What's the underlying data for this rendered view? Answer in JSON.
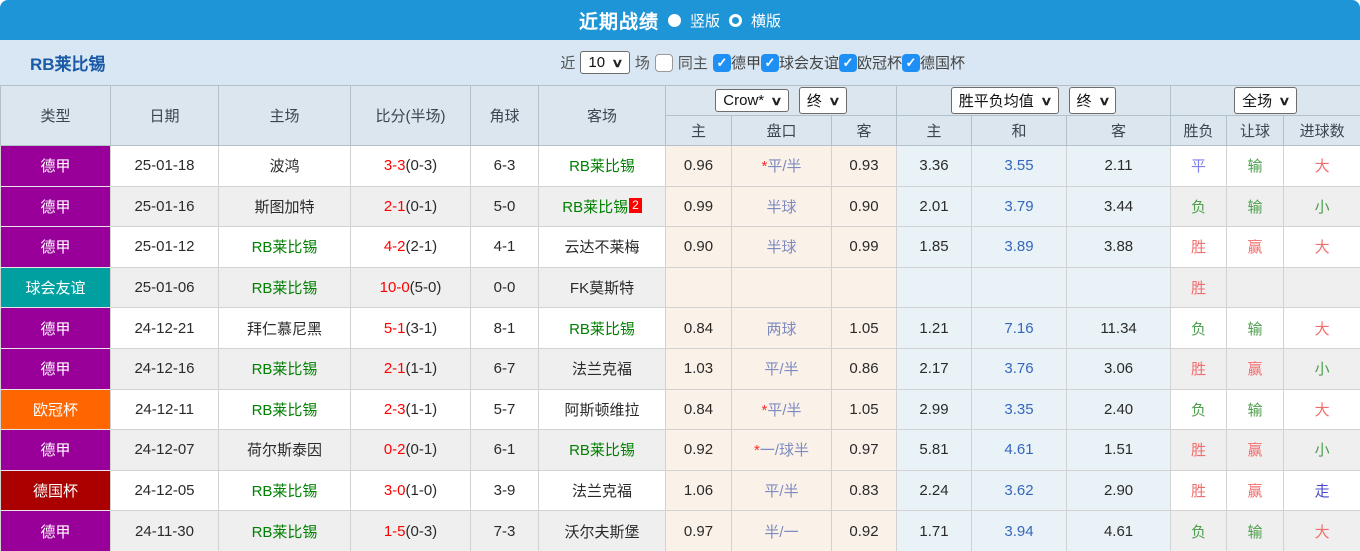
{
  "icons": {
    "chevron_down": "∨",
    "check": "✓"
  },
  "colors": {
    "topbar_blue": "#1e95d7",
    "filterbar_blue": "#d8e7f3",
    "header_gray": "#dce6ee",
    "league_dejia": "#990099",
    "league_friendly": "#00a0a0",
    "league_ucl": "#ff6600",
    "league_dfb": "#aa0000",
    "team_highlight_green": "#008000",
    "score_red": "#fe0000",
    "handicap_slate": "#7e8bc0",
    "avg_draw_blue": "#3666bb"
  },
  "topbar": {
    "title": "近期战绩",
    "vertical_label": "竖版",
    "horizontal_label": "横版"
  },
  "filterbar": {
    "team": "RB莱比锡",
    "recent_label": "近",
    "recent_count": "10",
    "matches_label": "场",
    "same_home_label": "同主",
    "leagues": [
      {
        "label": "德甲",
        "checked": true
      },
      {
        "label": "球会友谊",
        "checked": true
      },
      {
        "label": "欧冠杯",
        "checked": true
      },
      {
        "label": "德国杯",
        "checked": true
      }
    ]
  },
  "table": {
    "left_cols": [
      "类型",
      "日期",
      "主场",
      "比分(半场)",
      "角球",
      "客场"
    ],
    "group1": {
      "select_market": "Crow*",
      "select_time": "终",
      "cols": [
        "主",
        "盘口",
        "客"
      ]
    },
    "group2": {
      "select_market": "胜平负均值",
      "select_time": "终",
      "cols": [
        "主",
        "和",
        "客"
      ]
    },
    "group3": {
      "select_scope": "全场",
      "cols": [
        "胜负",
        "让球",
        "进球数"
      ]
    }
  },
  "result_colors": {
    "胜": "#f26d6d",
    "赢": "#f26d6d",
    "大": "#f26d6d",
    "负": "#4d9e4d",
    "输": "#4d9e4d",
    "小": "#4d9e4d",
    "平": "#8080f0",
    "走": "#4747d1"
  },
  "rows": [
    {
      "type": "德甲",
      "type_color": "#990099",
      "date": "25-01-18",
      "home": "波鸿",
      "home_hl": false,
      "home_badge": "",
      "score": "3-3",
      "half": "(0-3)",
      "corner": "6-3",
      "away": "RB莱比锡",
      "away_hl": true,
      "away_badge": "",
      "o1": "0.96",
      "star": "*",
      "handicap": "平/半",
      "o2": "0.93",
      "a1": "3.36",
      "a2": "3.55",
      "a3": "2.11",
      "r1": "平",
      "r2": "输",
      "r3": "大"
    },
    {
      "type": "德甲",
      "type_color": "#990099",
      "date": "25-01-16",
      "home": "斯图加特",
      "home_hl": false,
      "home_badge": "",
      "score": "2-1",
      "half": "(0-1)",
      "corner": "5-0",
      "away": "RB莱比锡",
      "away_hl": true,
      "away_badge": "2",
      "o1": "0.99",
      "star": "",
      "handicap": "半球",
      "o2": "0.90",
      "a1": "2.01",
      "a2": "3.79",
      "a3": "3.44",
      "r1": "负",
      "r2": "输",
      "r3": "小"
    },
    {
      "type": "德甲",
      "type_color": "#990099",
      "date": "25-01-12",
      "home": "RB莱比锡",
      "home_hl": true,
      "home_badge": "",
      "score": "4-2",
      "half": "(2-1)",
      "corner": "4-1",
      "away": "云达不莱梅",
      "away_hl": false,
      "away_badge": "",
      "o1": "0.90",
      "star": "",
      "handicap": "半球",
      "o2": "0.99",
      "a1": "1.85",
      "a2": "3.89",
      "a3": "3.88",
      "r1": "胜",
      "r2": "赢",
      "r3": "大"
    },
    {
      "type": "球会友谊",
      "type_color": "#00a0a0",
      "date": "25-01-06",
      "home": "RB莱比锡",
      "home_hl": true,
      "home_badge": "",
      "score": "10-0",
      "half": "(5-0)",
      "corner": "0-0",
      "away": "FK莫斯特",
      "away_hl": false,
      "away_badge": "",
      "o1": "",
      "star": "",
      "handicap": "",
      "o2": "",
      "a1": "",
      "a2": "",
      "a3": "",
      "r1": "胜",
      "r2": "",
      "r3": ""
    },
    {
      "type": "德甲",
      "type_color": "#990099",
      "date": "24-12-21",
      "home": "拜仁慕尼黑",
      "home_hl": false,
      "home_badge": "",
      "score": "5-1",
      "half": "(3-1)",
      "corner": "8-1",
      "away": "RB莱比锡",
      "away_hl": true,
      "away_badge": "",
      "o1": "0.84",
      "star": "",
      "handicap": "两球",
      "o2": "1.05",
      "a1": "1.21",
      "a2": "7.16",
      "a3": "11.34",
      "r1": "负",
      "r2": "输",
      "r3": "大"
    },
    {
      "type": "德甲",
      "type_color": "#990099",
      "date": "24-12-16",
      "home": "RB莱比锡",
      "home_hl": true,
      "home_badge": "",
      "score": "2-1",
      "half": "(1-1)",
      "corner": "6-7",
      "away": "法兰克福",
      "away_hl": false,
      "away_badge": "",
      "o1": "1.03",
      "star": "",
      "handicap": "平/半",
      "o2": "0.86",
      "a1": "2.17",
      "a2": "3.76",
      "a3": "3.06",
      "r1": "胜",
      "r2": "赢",
      "r3": "小"
    },
    {
      "type": "欧冠杯",
      "type_color": "#ff6600",
      "date": "24-12-11",
      "home": "RB莱比锡",
      "home_hl": true,
      "home_badge": "",
      "score": "2-3",
      "half": "(1-1)",
      "corner": "5-7",
      "away": "阿斯顿维拉",
      "away_hl": false,
      "away_badge": "",
      "o1": "0.84",
      "star": "*",
      "handicap": "平/半",
      "o2": "1.05",
      "a1": "2.99",
      "a2": "3.35",
      "a3": "2.40",
      "r1": "负",
      "r2": "输",
      "r3": "大"
    },
    {
      "type": "德甲",
      "type_color": "#990099",
      "date": "24-12-07",
      "home": "荷尔斯泰因",
      "home_hl": false,
      "home_badge": "",
      "score": "0-2",
      "half": "(0-1)",
      "corner": "6-1",
      "away": "RB莱比锡",
      "away_hl": true,
      "away_badge": "",
      "o1": "0.92",
      "star": "*",
      "handicap": "一/球半",
      "o2": "0.97",
      "a1": "5.81",
      "a2": "4.61",
      "a3": "1.51",
      "r1": "胜",
      "r2": "赢",
      "r3": "小"
    },
    {
      "type": "德国杯",
      "type_color": "#aa0000",
      "date": "24-12-05",
      "home": "RB莱比锡",
      "home_hl": true,
      "home_badge": "",
      "score": "3-0",
      "half": "(1-0)",
      "corner": "3-9",
      "away": "法兰克福",
      "away_hl": false,
      "away_badge": "",
      "o1": "1.06",
      "star": "",
      "handicap": "平/半",
      "o2": "0.83",
      "a1": "2.24",
      "a2": "3.62",
      "a3": "2.90",
      "r1": "胜",
      "r2": "赢",
      "r3": "走"
    },
    {
      "type": "德甲",
      "type_color": "#990099",
      "date": "24-11-30",
      "home": "RB莱比锡",
      "home_hl": true,
      "home_badge": "",
      "score": "1-5",
      "half": "(0-3)",
      "corner": "7-3",
      "away": "沃尔夫斯堡",
      "away_hl": false,
      "away_badge": "",
      "o1": "0.97",
      "star": "",
      "handicap": "半/一",
      "o2": "0.92",
      "a1": "1.71",
      "a2": "3.94",
      "a3": "4.61",
      "r1": "负",
      "r2": "输",
      "r3": "大"
    }
  ]
}
